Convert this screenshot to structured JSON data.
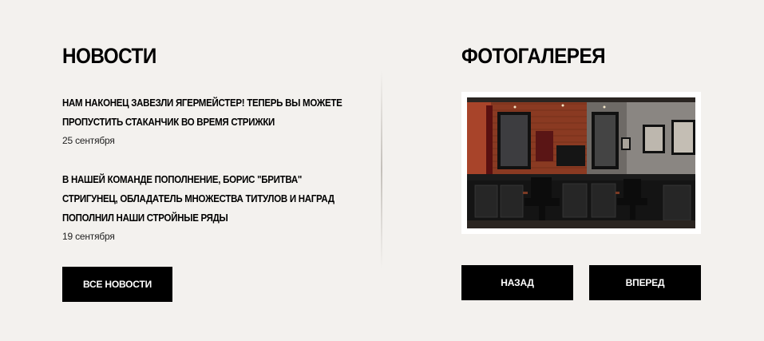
{
  "news": {
    "title": "НОВОСТИ",
    "items": [
      {
        "headline": "НАМ НАКОНЕЦ ЗАВЕЗЛИ ЯГЕРМЕЙСТЕР! ТЕПЕРЬ ВЫ МОЖЕТЕ ПРОПУСТИТЬ СТАКАНЧИК ВО ВРЕМЯ СТРИЖКИ",
        "date": "25 сентября"
      },
      {
        "headline": "В НАШЕЙ КОМАНДЕ ПОПОЛНЕНИЕ, БОРИС \"БРИТВА\" СТРИГУНЕЦ, ОБЛАДАТЕЛЬ МНОЖЕСТВА ТИТУЛОВ И НАГРАД ПОПОЛНИЛ НАШИ СТРОЙНЫЕ РЯДЫ",
        "date": "19 сентября"
      }
    ],
    "all_news_label": "ВСЕ НОВОСТИ"
  },
  "gallery": {
    "title": "ФОТОГАЛЕРЕЯ",
    "back_label": "НАЗАД",
    "forward_label": "ВПЕРЕД"
  },
  "colors": {
    "background": "#f3f1ee",
    "button": "#000000",
    "button_text": "#ffffff",
    "text": "#000000"
  }
}
